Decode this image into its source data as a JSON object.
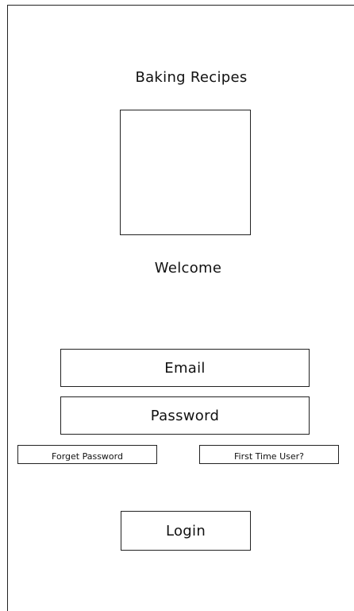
{
  "header": {
    "app_title": "Baking Recipes"
  },
  "main": {
    "welcome_text": "Welcome"
  },
  "form": {
    "email_placeholder": "Email",
    "password_placeholder": "Password",
    "forget_password_label": "Forget Password",
    "first_time_user_label": "First Time User?",
    "login_label": "Login"
  },
  "colors": {
    "border": "#222222",
    "background": "#ffffff",
    "text": "#111111"
  }
}
